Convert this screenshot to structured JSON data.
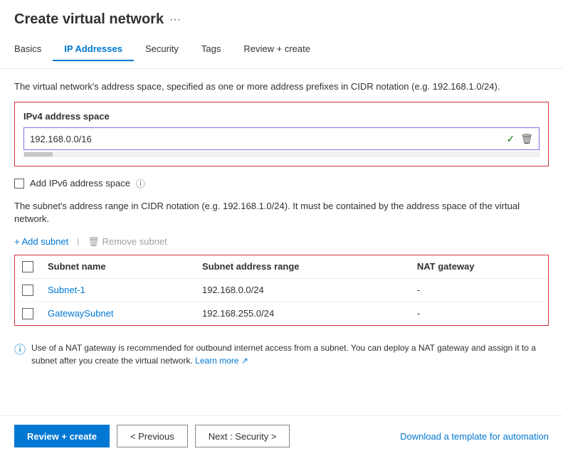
{
  "header": {
    "title": "Create virtual network",
    "ellipsis": "···"
  },
  "tabs": [
    {
      "id": "basics",
      "label": "Basics",
      "active": false
    },
    {
      "id": "ip-addresses",
      "label": "IP Addresses",
      "active": true
    },
    {
      "id": "security",
      "label": "Security",
      "active": false
    },
    {
      "id": "tags",
      "label": "Tags",
      "active": false
    },
    {
      "id": "review-create",
      "label": "Review + create",
      "active": false
    }
  ],
  "main": {
    "description": "The virtual network's address space, specified as one or more address prefixes in CIDR notation (e.g. 192.168.1.0/24).",
    "ipv4_section": {
      "label": "IPv4 address space",
      "value": "192.168.0.0/16"
    },
    "ipv6_checkbox_label": "Add IPv6 address space",
    "subnet_description": "The subnet's address range in CIDR notation (e.g. 192.168.1.0/24). It must be contained by the address space of the virtual network.",
    "add_subnet_label": "+ Add subnet",
    "remove_subnet_label": "Remove subnet",
    "table": {
      "columns": [
        "",
        "Subnet name",
        "Subnet address range",
        "NAT gateway"
      ],
      "rows": [
        {
          "name": "Subnet-1",
          "address_range": "192.168.0.0/24",
          "nat": "-"
        },
        {
          "name": "GatewaySubnet",
          "address_range": "192.168.255.0/24",
          "nat": "-"
        }
      ]
    },
    "info_banner": "Use of a NAT gateway is recommended for outbound internet access from a subnet. You can deploy a NAT gateway and assign it to a subnet after you create the virtual network.",
    "learn_more": "Learn more"
  },
  "footer": {
    "review_create_label": "Review + create",
    "previous_label": "< Previous",
    "next_label": "Next : Security >",
    "download_label": "Download a template for automation"
  },
  "icons": {
    "check": "✓",
    "delete": "🗑",
    "info": "ℹ",
    "external_link": "↗"
  }
}
